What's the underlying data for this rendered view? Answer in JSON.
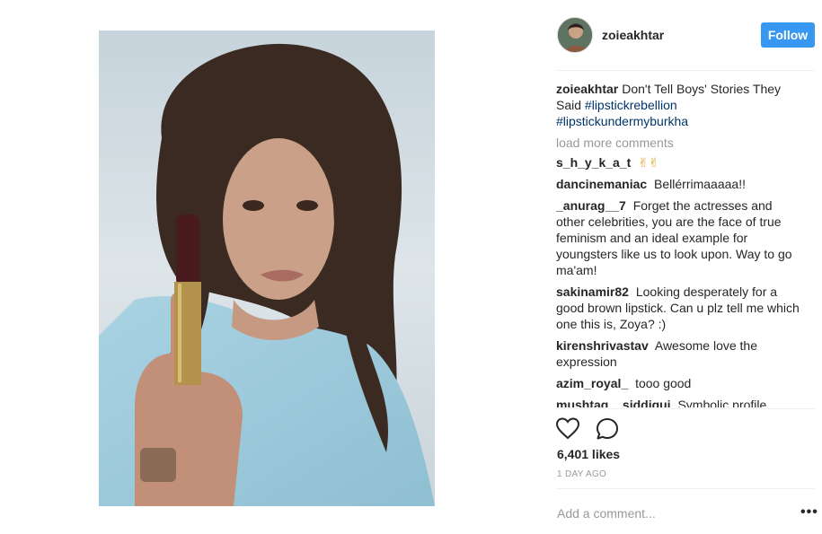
{
  "post": {
    "username": "zoieakhtar",
    "follow_label": "Follow",
    "caption": {
      "user": "zoieakhtar",
      "text": "Don't Tell Boys' Stories They Said",
      "tag1": "#lipstickrebellion",
      "tag2": "#lipstickundermyburkha"
    },
    "load_more": "load more comments",
    "comments": [
      {
        "user": "s_h_y_k_a_t",
        "text": "✌✌"
      },
      {
        "user": "dancinemaniac",
        "text": "Bellérrimaaaaa!!"
      },
      {
        "user": "_anurag__7",
        "text": "Forget the actresses and other celebrities, you are the face of true feminism and an ideal example for youngsters like us to look upon. Way to go ma'am!"
      },
      {
        "user": "sakinamir82",
        "text": "Looking desperately for a good brown lipstick. Can u plz tell me which one this is, Zoya? :)"
      },
      {
        "user": "kirenshrivastav",
        "text": "Awesome love the expression"
      },
      {
        "user": "azim_royal_",
        "text": "tooo good"
      },
      {
        "user": "mushtaq__siddiqui",
        "text": "Symbolic profile"
      }
    ],
    "likes": "6,401 likes",
    "time": "1 DAY AGO",
    "add_comment_placeholder": "Add a comment...",
    "more_label": "•••",
    "icons": {
      "like": "heart-icon",
      "comment": "comment-icon",
      "options": "more-options-icon"
    },
    "colors": {
      "follow_bg": "#3897f0",
      "hashtag": "#003569",
      "muted": "#999999"
    }
  }
}
